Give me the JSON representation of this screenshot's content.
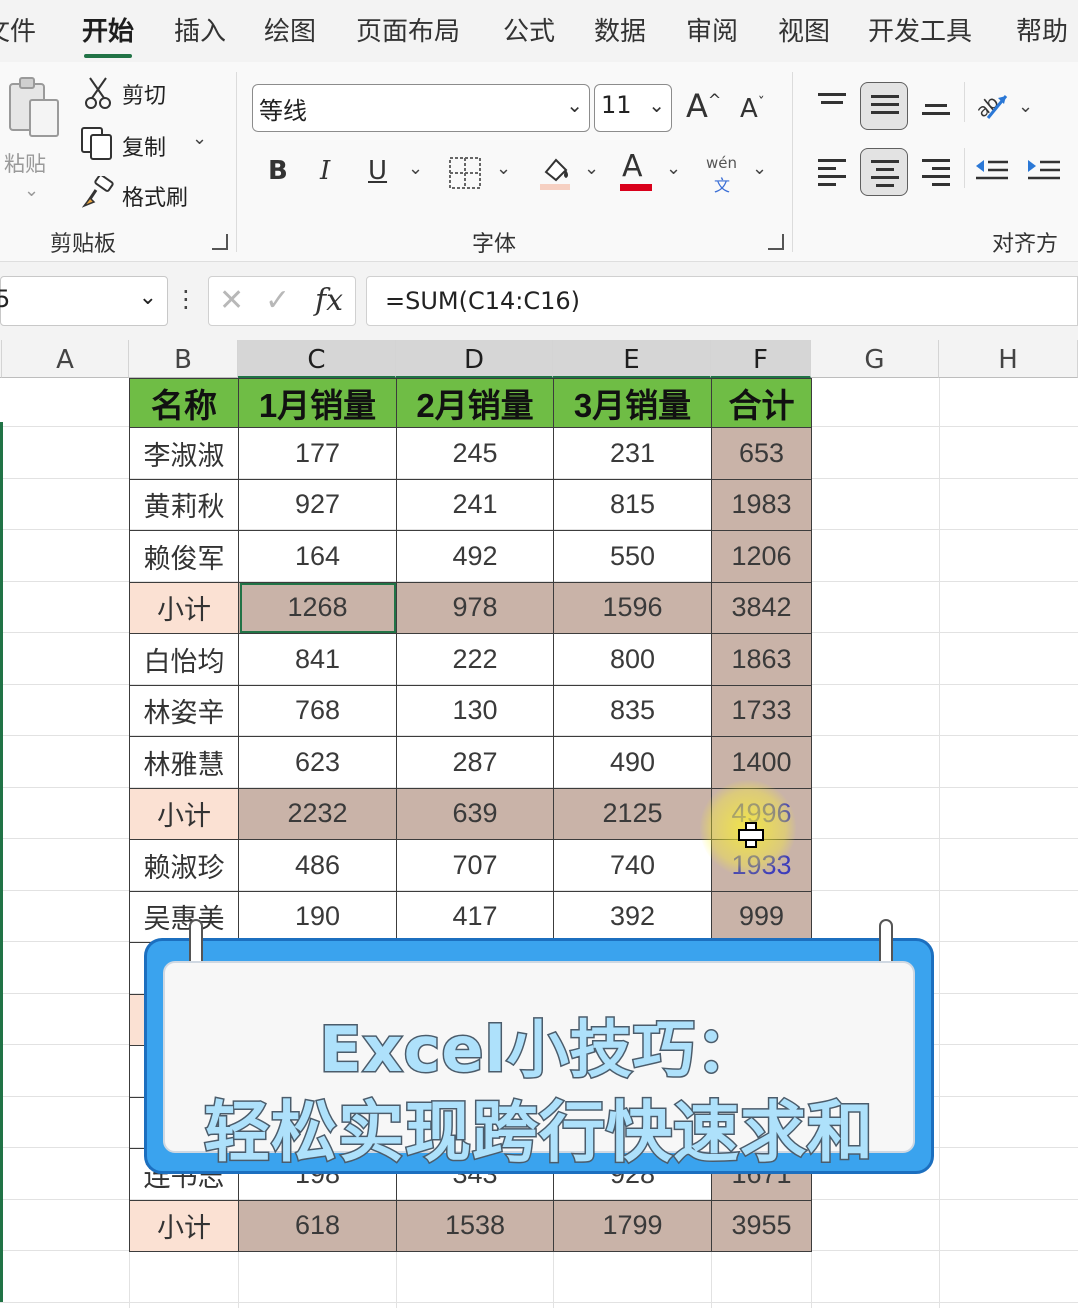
{
  "menu": {
    "tabs": [
      {
        "label": "文件"
      },
      {
        "label": "开始"
      },
      {
        "label": "插入"
      },
      {
        "label": "绘图"
      },
      {
        "label": "页面布局"
      },
      {
        "label": "公式"
      },
      {
        "label": "数据"
      },
      {
        "label": "审阅"
      },
      {
        "label": "视图"
      },
      {
        "label": "开发工具"
      },
      {
        "label": "帮助"
      }
    ],
    "active": "开始"
  },
  "ribbon": {
    "clipboard": {
      "paste_label": "粘贴",
      "cut_label": "剪切",
      "copy_label": "复制",
      "format_painter_label": "格式刷",
      "group_label": "剪贴板"
    },
    "font": {
      "font_name": "等线",
      "font_size": "11",
      "grow_label": "A",
      "shrink_label": "A",
      "bold_label": "B",
      "italic_label": "I",
      "underline_label": "U",
      "phonetic_top": "wén",
      "phonetic_bottom": "文",
      "font_color_label": "A",
      "font_color": "#d9001b",
      "group_label": "字体"
    },
    "alignment": {
      "group_label": "对齐方式"
    }
  },
  "formula_bar": {
    "name_box": "5",
    "fx_label": "fx",
    "formula": "=SUM(C14:C16)"
  },
  "columns": [
    "A",
    "B",
    "C",
    "D",
    "E",
    "F",
    "G",
    "H"
  ],
  "sheet": {
    "headers": [
      "名称",
      "1月销量",
      "2月销量",
      "3月销量",
      "合计"
    ],
    "rows": [
      {
        "name": "李淑淑",
        "values": [
          "177",
          "245",
          "231"
        ],
        "total": "653",
        "subtotal": false
      },
      {
        "name": "黄莉秋",
        "values": [
          "927",
          "241",
          "815"
        ],
        "total": "1983",
        "subtotal": false
      },
      {
        "name": "赖俊军",
        "values": [
          "164",
          "492",
          "550"
        ],
        "total": "1206",
        "subtotal": false
      },
      {
        "name": "小计",
        "values": [
          "1268",
          "978",
          "1596"
        ],
        "total": "3842",
        "subtotal": true
      },
      {
        "name": "白怡均",
        "values": [
          "841",
          "222",
          "800"
        ],
        "total": "1863",
        "subtotal": false
      },
      {
        "name": "林姿辛",
        "values": [
          "768",
          "130",
          "835"
        ],
        "total": "1733",
        "subtotal": false
      },
      {
        "name": "林雅慧",
        "values": [
          "623",
          "287",
          "490"
        ],
        "total": "1400",
        "subtotal": false
      },
      {
        "name": "小计",
        "values": [
          "2232",
          "639",
          "2125"
        ],
        "total": "4996",
        "subtotal": true
      },
      {
        "name": "赖淑珍",
        "values": [
          "486",
          "707",
          "740"
        ],
        "total": "1933",
        "subtotal": false
      },
      {
        "name": "吴惠美",
        "values": [
          "190",
          "417",
          "392"
        ],
        "total": "999",
        "subtotal": false
      },
      {
        "name": "",
        "values": [
          "",
          "",
          ""
        ],
        "total": "",
        "subtotal": false
      },
      {
        "name": "",
        "values": [
          "",
          "",
          ""
        ],
        "total": "",
        "subtotal": true
      },
      {
        "name": "",
        "values": [
          "",
          "",
          ""
        ],
        "total": "",
        "subtotal": false
      },
      {
        "name": "",
        "values": [
          "",
          "",
          ""
        ],
        "total": "",
        "subtotal": false
      },
      {
        "name": "连书志",
        "values": [
          "198",
          "343",
          "928"
        ],
        "total": "1671",
        "subtotal": false
      },
      {
        "name": "小计",
        "values": [
          "618",
          "1538",
          "1799"
        ],
        "total": "3955",
        "subtotal": true
      }
    ]
  },
  "banner": {
    "line1": "Excel小技巧：",
    "line2": "轻松实现跨行快速求和"
  },
  "colors": {
    "header_green": "#6fbd45",
    "subtotal_fill": "#c9b3a8",
    "subtotal_label_fill": "#fbe1d3",
    "excel_green": "#217346",
    "banner_blue": "#3aa3ee"
  }
}
